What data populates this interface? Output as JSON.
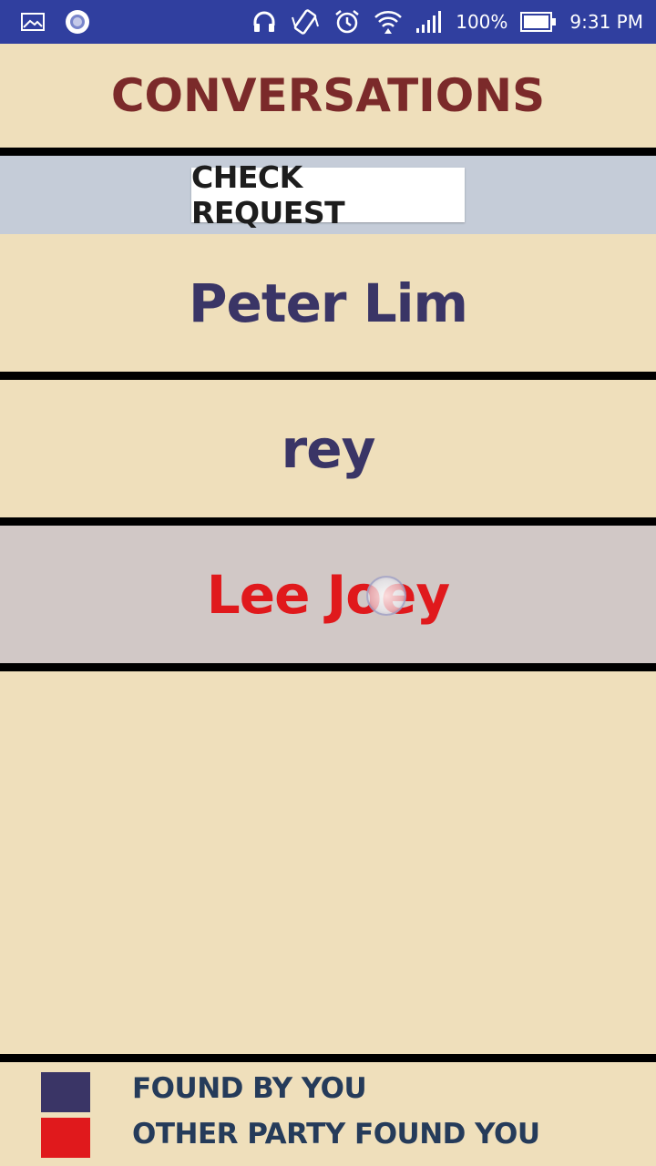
{
  "status_bar": {
    "icons": [
      "image-icon",
      "record-icon",
      "headphones-icon",
      "vibrate-icon",
      "alarm-icon",
      "wifi-icon",
      "signal-icon",
      "battery-icon"
    ],
    "battery": "100%",
    "time": "9:31 PM"
  },
  "header": {
    "title": "CONVERSATIONS"
  },
  "request": {
    "button_label": "CHECK REQUEST"
  },
  "conversations": [
    {
      "name": "Peter Lim",
      "color": "#3a3566",
      "found_by": "you"
    },
    {
      "name": "rey",
      "color": "#3a3566",
      "found_by": "you"
    },
    {
      "name": "Lee Joey",
      "color": "#e0191c",
      "found_by": "other_party"
    }
  ],
  "legend": {
    "items": [
      {
        "label": "FOUND BY YOU",
        "color": "#3a3566"
      },
      {
        "label": "OTHER PARTY FOUND YOU",
        "color": "#e0191c"
      }
    ]
  },
  "colors": {
    "background": "#efdfbb",
    "status_bar": "#303f9f",
    "title": "#7b2a2a",
    "request_bar": "#c5ccd8",
    "selected_row": "#d1c8c6",
    "legend_text": "#253b5a"
  }
}
